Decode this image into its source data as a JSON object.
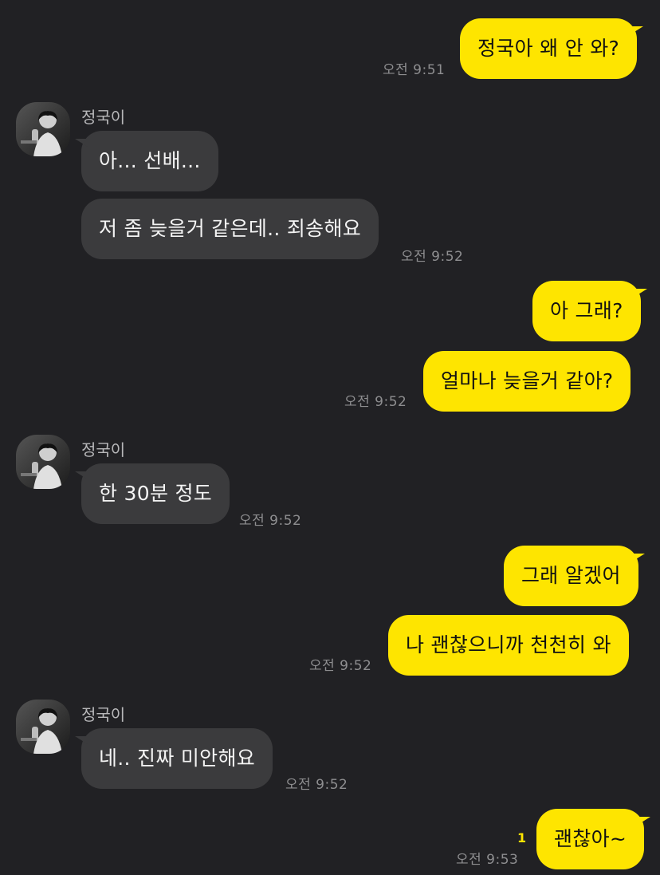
{
  "chat": {
    "messages": [
      {
        "from": "me",
        "text": "정국아 왜 안 와?",
        "time": "오전 9:51"
      },
      {
        "from": "contact",
        "sender": "정국이",
        "lines": [
          "아... 선배...",
          "저 좀 늦을거 같은데.. 죄송해요"
        ],
        "time": "오전 9:52"
      },
      {
        "from": "me",
        "lines": [
          "아 그래?",
          "얼마나 늦을거 같아?"
        ],
        "time": "오전 9:52"
      },
      {
        "from": "contact",
        "sender": "정국이",
        "text": "한 30분 정도",
        "time": "오전 9:52"
      },
      {
        "from": "me",
        "lines": [
          "그래 알겠어",
          "나 괜찮으니까 천천히 와"
        ],
        "time": "오전 9:52"
      },
      {
        "from": "contact",
        "sender": "정국이",
        "text": "네.. 진짜 미안해요",
        "time": "오전 9:52"
      },
      {
        "from": "me",
        "text": "괜찮아~",
        "time": "오전 9:53",
        "unread": "1"
      }
    ]
  },
  "colors": {
    "background": "#212124",
    "outgoing_bubble": "#fee500",
    "incoming_bubble": "#3b3b3d",
    "timestamp": "#8e8e90",
    "unread_badge": "#fee500"
  },
  "icons": {
    "avatar": "profile-photo-icon"
  }
}
